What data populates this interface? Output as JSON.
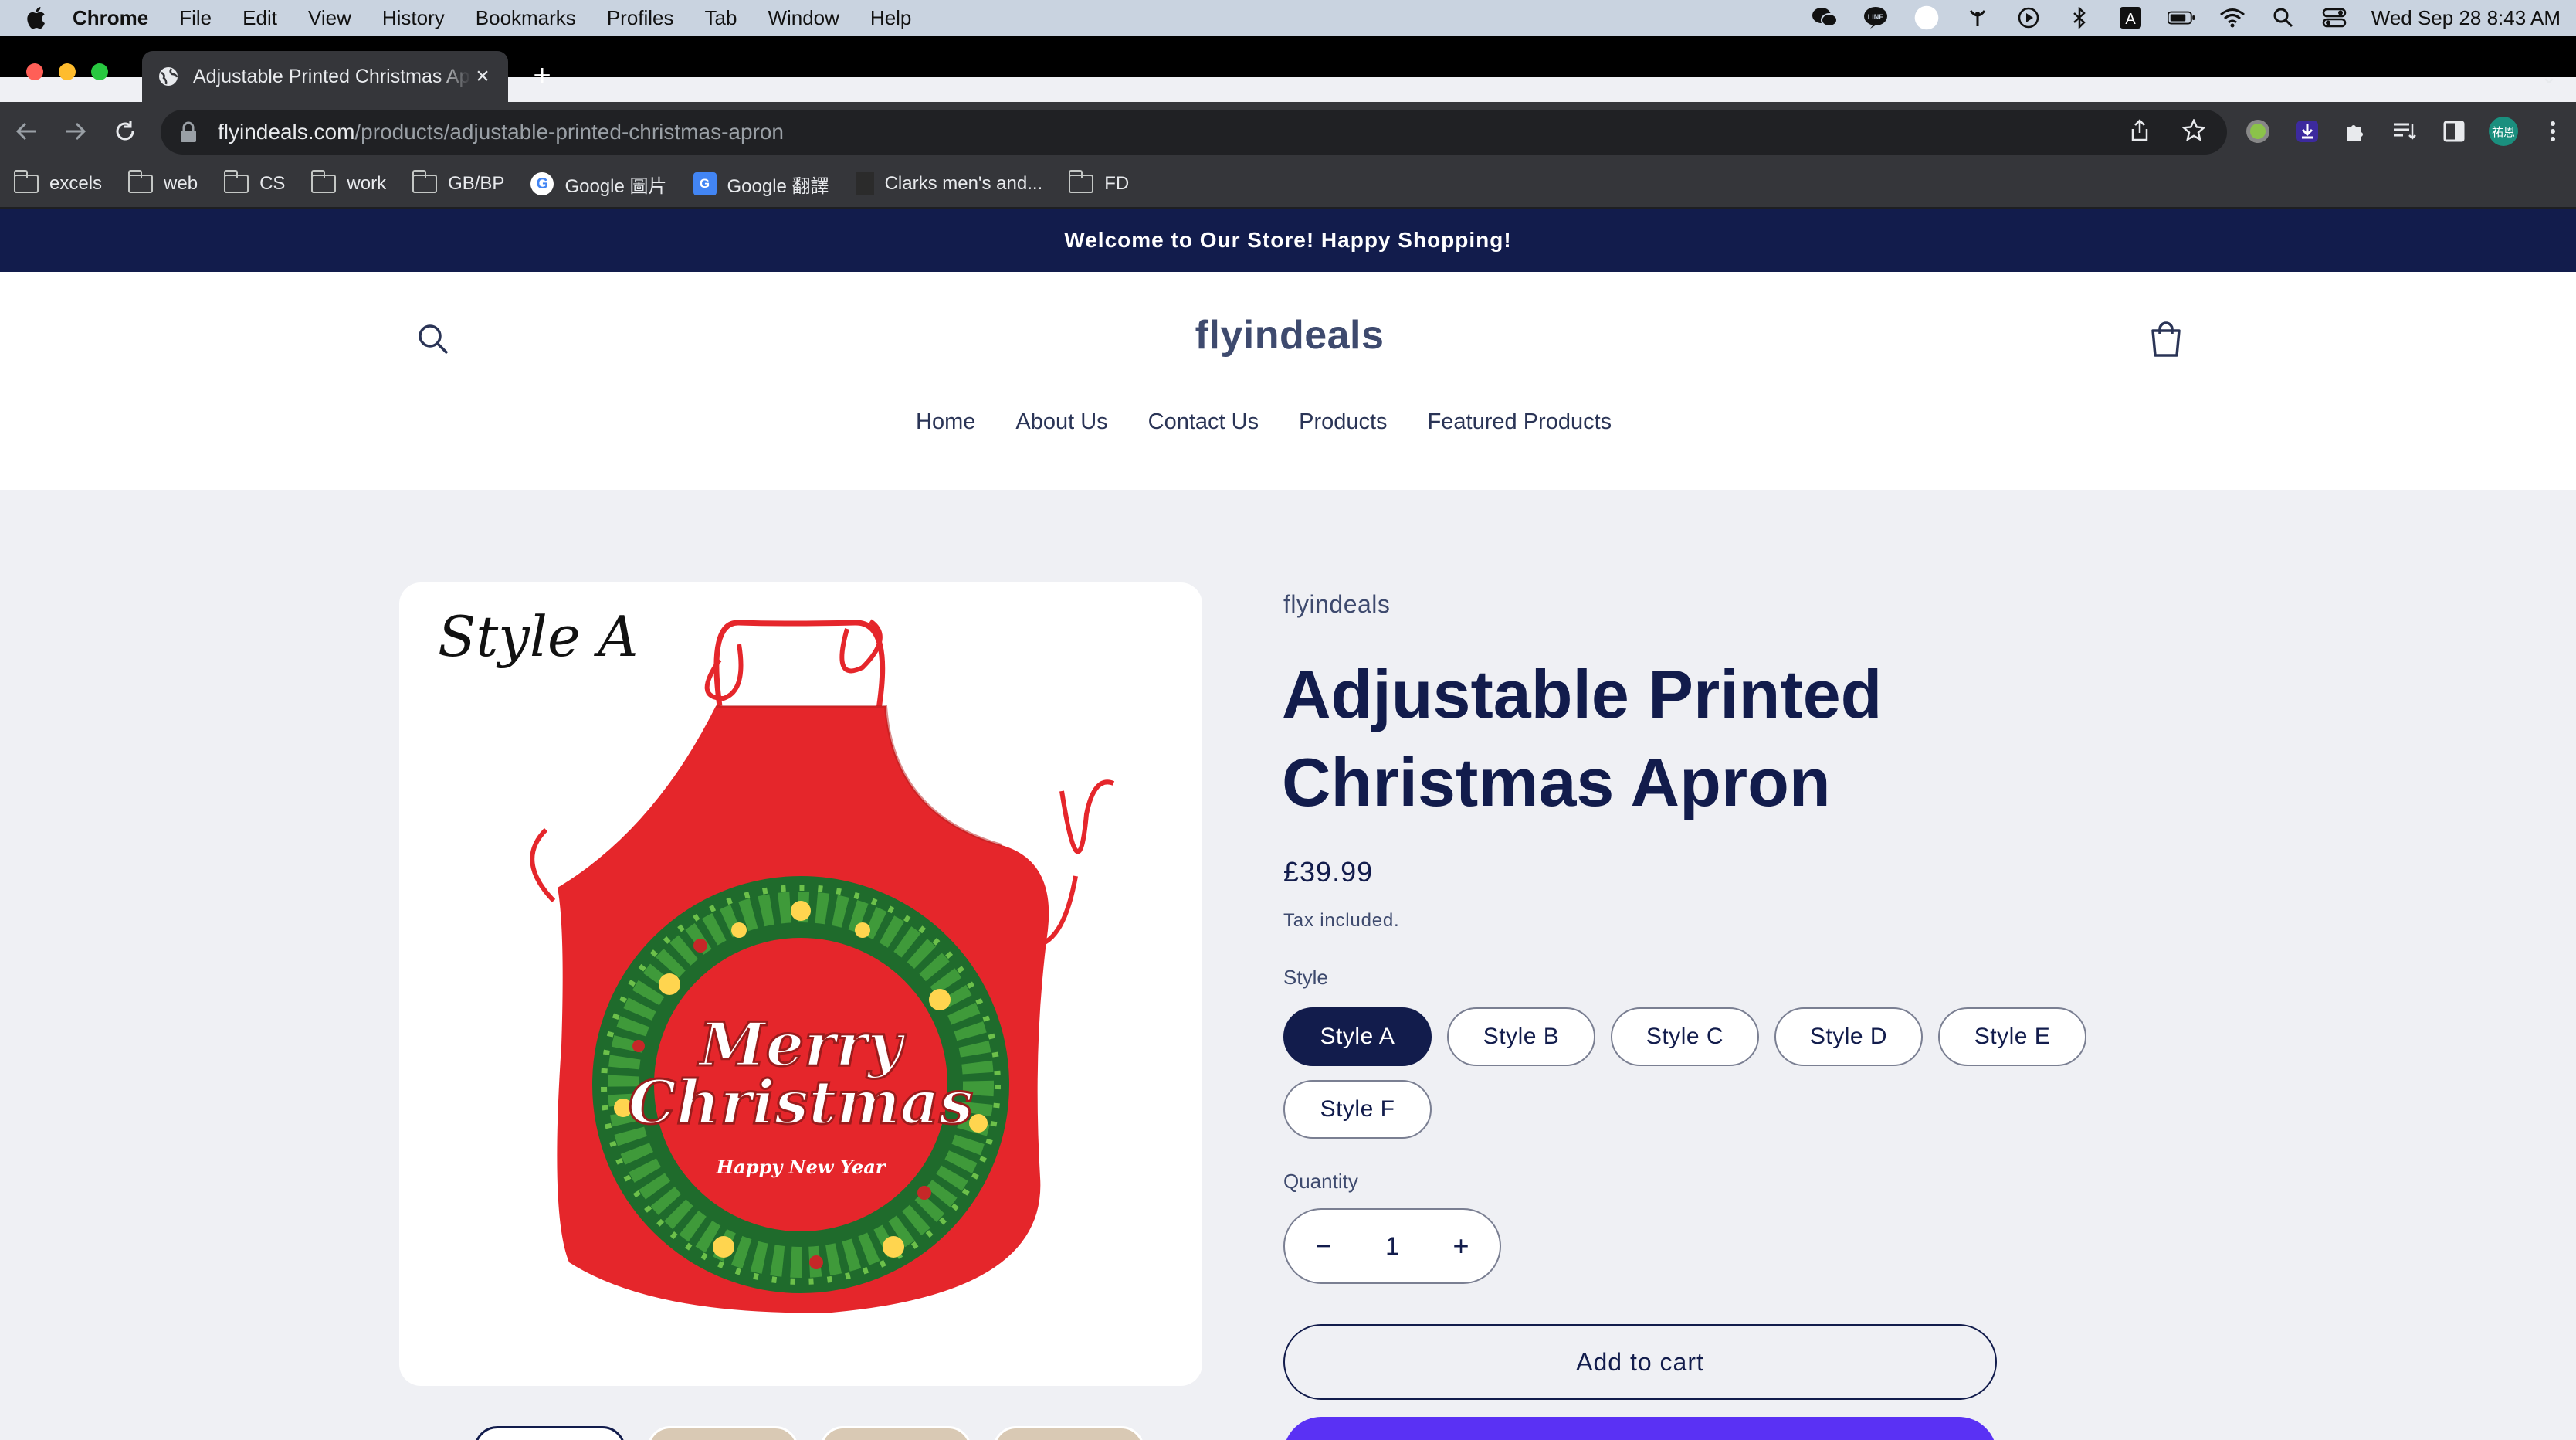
{
  "menubar": {
    "app_name": "Chrome",
    "items": [
      "File",
      "Edit",
      "View",
      "History",
      "Bookmarks",
      "Profiles",
      "Tab",
      "Window",
      "Help"
    ],
    "clock": "Wed Sep 28  8:43 AM",
    "status_icons": [
      "wechat-icon",
      "line-icon",
      "user-icon",
      "antenna-icon",
      "play-icon",
      "bluetooth-icon",
      "keyboard-a-icon",
      "battery-icon",
      "wifi-icon",
      "spotlight-icon",
      "control-center-icon"
    ]
  },
  "browser": {
    "tab_title": "Adjustable Printed Christmas Apron",
    "url_host": "flyindeals.com",
    "url_path": "/products/adjustable-printed-christmas-apron",
    "profile_initials": "祐恩"
  },
  "bookmarks": [
    {
      "label": "excels",
      "icon": "folder-icon"
    },
    {
      "label": "web",
      "icon": "folder-icon"
    },
    {
      "label": "CS",
      "icon": "folder-icon"
    },
    {
      "label": "work",
      "icon": "folder-icon"
    },
    {
      "label": "GB/BP",
      "icon": "folder-icon"
    },
    {
      "label": "Google 圖片",
      "icon": "google-icon"
    },
    {
      "label": "Google 翻譯",
      "icon": "translate-icon"
    },
    {
      "label": "Clarks men's and...",
      "icon": "clarks-icon"
    },
    {
      "label": "FD",
      "icon": "folder-icon"
    }
  ],
  "store": {
    "announcement": "Welcome to Our Store! Happy Shopping!",
    "logo": "flyindeals",
    "nav": [
      "Home",
      "About Us",
      "Contact Us",
      "Products",
      "Featured Products"
    ]
  },
  "product": {
    "image_caption": "Style A",
    "vendor": "flyindeals",
    "title": "Adjustable Printed Christmas Apron",
    "price": "£39.99",
    "tax_note": "Tax included.",
    "option_label": "Style",
    "variants": [
      "Style A",
      "Style B",
      "Style C",
      "Style D",
      "Style E",
      "Style F"
    ],
    "selected_variant": "Style A",
    "quantity_label": "Quantity",
    "quantity": "1",
    "add_to_cart": "Add to cart",
    "apron_text_main": "Merry Christmas",
    "apron_text_sub": "Happy New Year"
  },
  "colors": {
    "brand_navy": "#121c4c",
    "apron_red": "#e5262b",
    "buy_now_purple": "#5a31f4"
  }
}
